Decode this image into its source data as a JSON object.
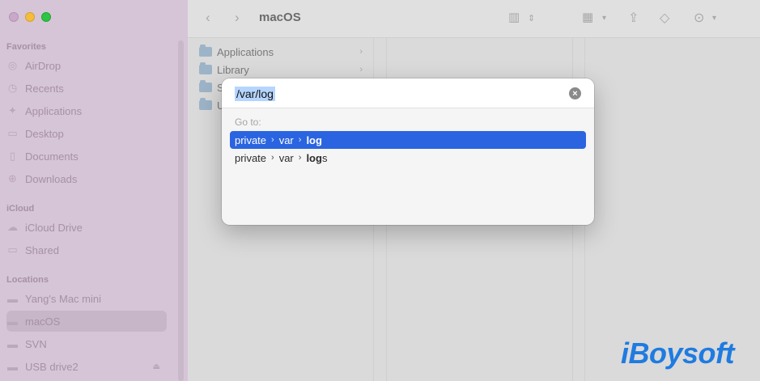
{
  "window": {
    "title": "macOS"
  },
  "sidebar": {
    "sections": [
      {
        "header": "Favorites",
        "items": [
          {
            "label": "AirDrop",
            "icon": "airdrop-icon"
          },
          {
            "label": "Recents",
            "icon": "clock-icon"
          },
          {
            "label": "Applications",
            "icon": "applications-icon"
          },
          {
            "label": "Desktop",
            "icon": "desktop-icon"
          },
          {
            "label": "Documents",
            "icon": "document-icon"
          },
          {
            "label": "Downloads",
            "icon": "download-icon"
          }
        ]
      },
      {
        "header": "iCloud",
        "items": [
          {
            "label": "iCloud Drive",
            "icon": "cloud-icon"
          },
          {
            "label": "Shared",
            "icon": "shared-folder-icon"
          }
        ]
      },
      {
        "header": "Locations",
        "items": [
          {
            "label": "Yang's Mac mini",
            "icon": "computer-icon"
          },
          {
            "label": "macOS",
            "icon": "disk-icon",
            "selected": true
          },
          {
            "label": "SVN",
            "icon": "disk-icon"
          },
          {
            "label": "USB drive2",
            "icon": "disk-icon"
          }
        ]
      }
    ]
  },
  "column": {
    "items": [
      "Applications",
      "Library",
      "S",
      "U"
    ]
  },
  "dialog": {
    "input_value": "/var/log",
    "goto_label": "Go to:",
    "results": [
      {
        "parts": [
          "private",
          "var"
        ],
        "bold": "log",
        "suffix": ""
      },
      {
        "parts": [
          "private",
          "var"
        ],
        "bold": "log",
        "suffix": "s"
      }
    ]
  },
  "watermark": "iBoysoft",
  "colors": {
    "accent": "#2a64e0",
    "sidebar": "#d6c5d6",
    "brand": "#1f7be0"
  }
}
